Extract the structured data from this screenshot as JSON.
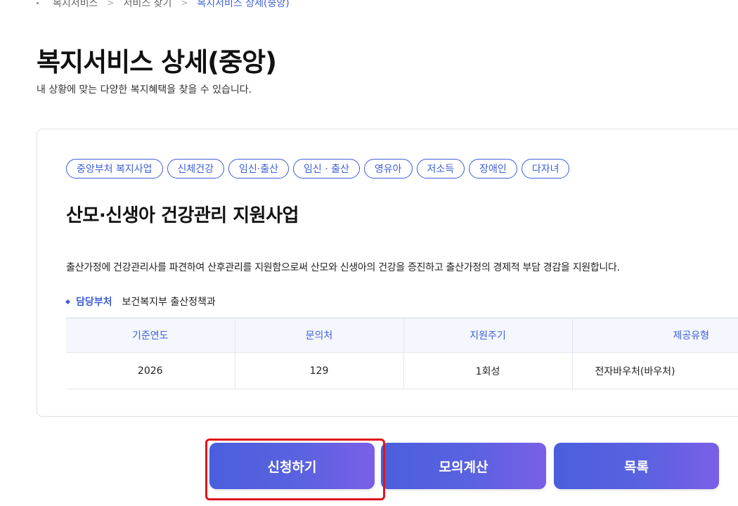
{
  "breadcrumb": {
    "items": [
      "복지서비스",
      "서비스 찾기",
      "복지서비스 상세(중앙)"
    ]
  },
  "page": {
    "title": "복지서비스 상세(중앙)",
    "subtitle": "내 상황에 맞는 다양한 복지혜택을 찾을 수 있습니다."
  },
  "service": {
    "tags": [
      "중앙부처 복지사업",
      "신체건강",
      "임신·출산",
      "임신 · 출산",
      "영유아",
      "저소득",
      "장애인",
      "다자녀"
    ],
    "title": "산모·신생아 건강관리 지원사업",
    "description": "출산가정에 건강관리사를 파견하여 산후관리를 지원함으로써 산모와 신생아의 건강을 증진하고 출산가정의 경제적 부담 경감을 지원합니다.",
    "dept_label": "담당부처",
    "dept_value": "보건복지부 출산정책과"
  },
  "table": {
    "headers": [
      "기준연도",
      "문의처",
      "지원주기",
      "제공유형"
    ],
    "row": [
      "2026",
      "129",
      "1회성",
      "전자바우처(바우처)"
    ]
  },
  "buttons": {
    "apply": "신청하기",
    "calc": "모의계산",
    "list": "목록"
  },
  "colors": {
    "accent": "#3e5fd6",
    "button_gradient_start": "#4a5fdd",
    "button_gradient_end": "#7a5fe6",
    "highlight": "#e0141e"
  }
}
